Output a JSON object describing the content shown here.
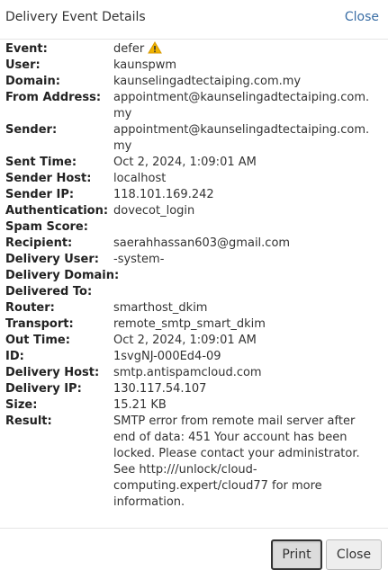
{
  "header": {
    "title": "Delivery Event Details",
    "close_label": "Close"
  },
  "details": [
    {
      "label": "Event:",
      "value": "defer",
      "icon": "warning-icon"
    },
    {
      "label": "User:",
      "value": "kaunspwm"
    },
    {
      "label": "Domain:",
      "value": "kaunselingadtectaiping.com.my"
    },
    {
      "label": "From Address:",
      "value": "appointment@kaunselingadtectaiping.com.my"
    },
    {
      "label": "Sender:",
      "value": "appointment@kaunselingadtectaiping.com.my"
    },
    {
      "label": "Sent Time:",
      "value": "Oct 2, 2024, 1:09:01 AM"
    },
    {
      "label": "Sender Host:",
      "value": "localhost"
    },
    {
      "label": "Sender IP:",
      "value": "118.101.169.242"
    },
    {
      "label": "Authentication:",
      "value": "dovecot_login"
    },
    {
      "label": "Spam Score:",
      "value": ""
    },
    {
      "label": "Recipient:",
      "value": "saerahhassan603@gmail.com"
    },
    {
      "label": "Delivery User:",
      "value": "-system-"
    },
    {
      "label": "Delivery Domain:",
      "value": ""
    },
    {
      "label": "Delivered To:",
      "value": ""
    },
    {
      "label": "Router:",
      "value": "smarthost_dkim"
    },
    {
      "label": "Transport:",
      "value": "remote_smtp_smart_dkim"
    },
    {
      "label": "Out Time:",
      "value": "Oct 2, 2024, 1:09:01 AM"
    },
    {
      "label": "ID:",
      "value": "1svgNJ-000Ed4-09"
    },
    {
      "label": "Delivery Host:",
      "value": "smtp.antispamcloud.com"
    },
    {
      "label": "Delivery IP:",
      "value": "130.117.54.107"
    },
    {
      "label": "Size:",
      "value": "15.21 KB"
    },
    {
      "label": "Result:",
      "value": "SMTP error from remote mail server after end of data: 451 Your account has been locked. Please contact your administrator. See http:///unlock/cloud-computing.expert/cloud77 for more information."
    }
  ],
  "footer": {
    "print_label": "Print",
    "close_label": "Close"
  },
  "colors": {
    "link": "#3a6ea5",
    "warning": "#f0b400"
  }
}
